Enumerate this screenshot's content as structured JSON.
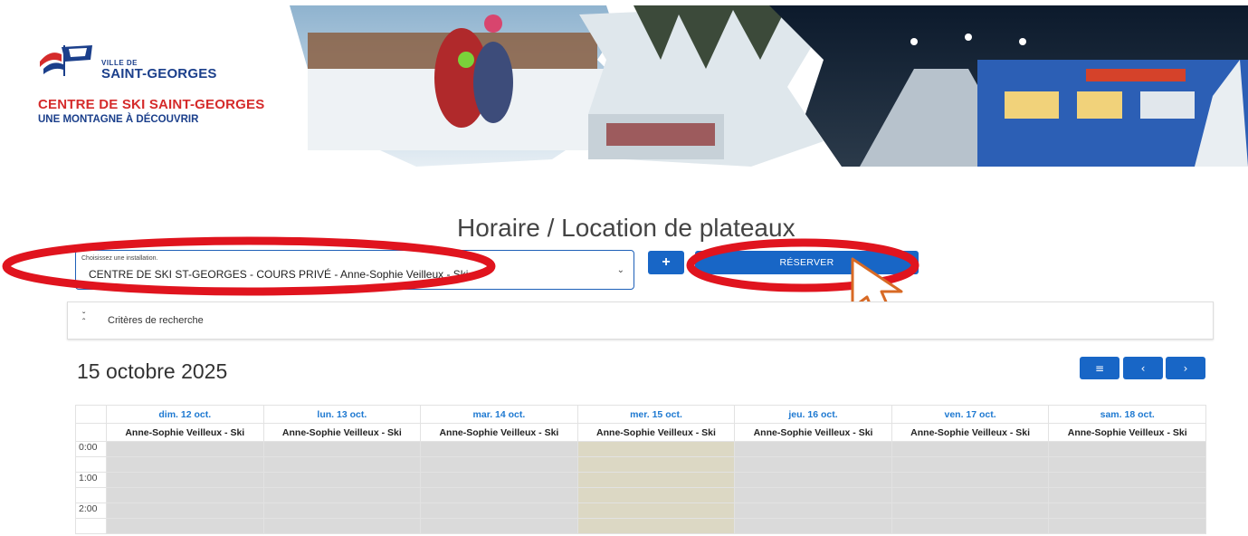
{
  "header": {
    "ville_de": "VILLE DE",
    "city": "SAINT-GEORGES",
    "center_name": "CENTRE DE SKI SAINT-GEORGES",
    "tagline": "UNE MONTAGNE À DÉCOUVRIR"
  },
  "page": {
    "title": "Horaire / Location de plateaux"
  },
  "facility": {
    "label": "Choisissez une installation.",
    "value": "CENTRE DE SKI ST-GEORGES - COURS PRIVÉ - Anne-Sophie Veilleux - Ski"
  },
  "actions": {
    "plus": "+",
    "reserve": "RÉSERVER"
  },
  "criteria": {
    "label": "Critères de recherche"
  },
  "calendar": {
    "current_date": "15 octobre 2025",
    "days": [
      "dim. 12 oct.",
      "lun. 13 oct.",
      "mar. 14 oct.",
      "mer. 15 oct.",
      "jeu. 16 oct.",
      "ven. 17 oct.",
      "sam. 18 oct."
    ],
    "resource": "Anne-Sophie Veilleux - Ski",
    "times": [
      "0:00",
      "1:00",
      "2:00"
    ],
    "today_index": 3
  },
  "colors": {
    "primary": "#1866c6",
    "annotation": "#e0141e",
    "slot": "#dadada",
    "today_slot": "#dcd8c4"
  }
}
